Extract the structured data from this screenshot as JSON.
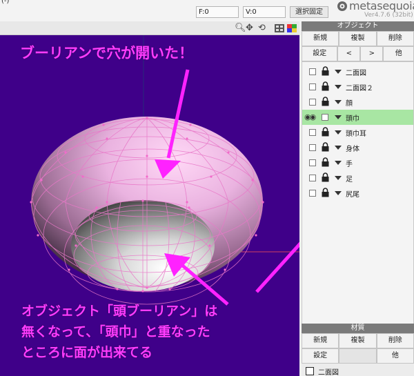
{
  "topbar": {
    "faces_field": "F:0",
    "vertices_field": "V:0",
    "selection_fix_button": "選択固定",
    "trunc_text": "(-)"
  },
  "logo": {
    "name": "metasequoia",
    "version": "Ver4.7.6 (32bit)"
  },
  "viewport": {
    "caption_top": "ブーリアンで穴が開いた！",
    "caption_bottom_lines": [
      "オブジェクト「頭ブーリアン」は",
      "無くなって、「頭巾」と重なった",
      "ところに面が出来てる"
    ],
    "tools": [
      "zoom-icon",
      "move-icon",
      "rotate-icon",
      "grid-toggle-icon",
      "color-toggle-icon"
    ]
  },
  "object_panel": {
    "title": "オブジェクト",
    "row1": [
      "新規",
      "複製",
      "削除"
    ],
    "row2": [
      "設定",
      "<",
      ">",
      "他"
    ],
    "objects": [
      {
        "name": "二面図",
        "selected": false,
        "visible_eyes": false
      },
      {
        "name": "二面図２",
        "selected": false,
        "visible_eyes": false
      },
      {
        "name": "顔",
        "selected": false,
        "visible_eyes": false
      },
      {
        "name": "頭巾",
        "selected": true,
        "visible_eyes": true
      },
      {
        "name": "頭巾耳",
        "selected": false,
        "visible_eyes": false
      },
      {
        "name": "身体",
        "selected": false,
        "visible_eyes": false
      },
      {
        "name": "手",
        "selected": false,
        "visible_eyes": false
      },
      {
        "name": "足",
        "selected": false,
        "visible_eyes": false
      },
      {
        "name": "尻尾",
        "selected": false,
        "visible_eyes": false
      }
    ]
  },
  "material_panel": {
    "title": "材質",
    "row1": [
      "新規",
      "複製",
      "削除"
    ],
    "row2": [
      "設定",
      "",
      "他"
    ],
    "materials": [
      {
        "name": "二面図"
      }
    ]
  },
  "colors": {
    "viewport_bg": "#3f0089",
    "caption": "#ff3cff",
    "arrow": "#ff22ff",
    "selected_row": "#a8e6a3",
    "mesh_line": "#e878c8"
  }
}
